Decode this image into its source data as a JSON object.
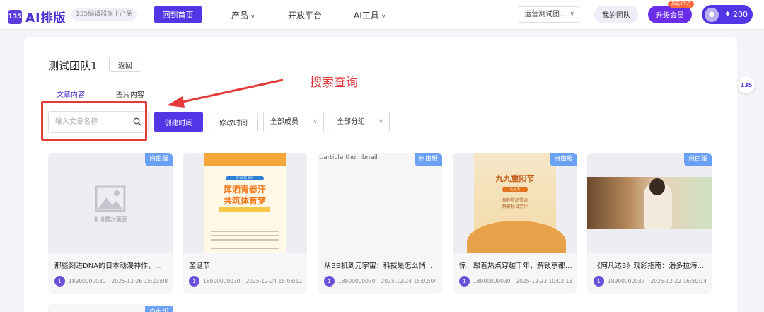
{
  "header": {
    "logo_mark": "135",
    "logo_text": "AI排版",
    "logo_sub": "135编辑器旗下产品",
    "home_button": "回到首页",
    "nav": {
      "products": "产品",
      "open_platform": "开放平台",
      "ai_tools": "AI工具"
    },
    "team_select": "运营测试团...",
    "my_team": "我的团队",
    "upgrade": "升级会员",
    "upgrade_tag": "加送4个月",
    "points": "200"
  },
  "side_badge": "135",
  "page": {
    "team_title": "测试团队1",
    "back_button": "返回",
    "annotation": "搜索查询",
    "tabs": [
      "文章内容",
      "图片内容"
    ],
    "search_placeholder": "输入文章名称",
    "filters": {
      "created_time": "创建时间",
      "modified_time": "修改时间",
      "members": "全部成员",
      "groups": "全部分组"
    }
  },
  "cards": [
    {
      "badge": "自由版",
      "placeholder": "未设置封面图",
      "title": "那些刻进DNA的日本动漫神作，资...",
      "avatar": "1",
      "user": "18900000030",
      "date": "2025-12-26 15:23:08"
    },
    {
      "badge": "",
      "poster_top": "SPORTS DAY",
      "poster_line1": "挥洒青春汗",
      "poster_line2": "共筑体育梦",
      "title": "圣诞节",
      "avatar": "1",
      "user": "18900000030",
      "date": "2025-12-24 15:08:12"
    },
    {
      "badge": "自由版",
      "broken_alt": "article thumbnail",
      "title": "从BB机到元宇宙：科技是怎么悄...",
      "avatar": "1",
      "user": "18900000030",
      "date": "2025-12-24 15:02:04"
    },
    {
      "badge": "自由版",
      "poster_title": "九九重阳节",
      "poster_pill": "九月九",
      "poster_sub1": "相伴登高望远",
      "poster_sub2": "静赏秋日芳华",
      "title": "惊！跟着热点穿越千年，解锁京都...",
      "avatar": "1",
      "user": "18900000030",
      "date": "2025-12-23 10:02:13"
    },
    {
      "badge": "自由版",
      "title": "《阿凡达3》观影指南：潘多拉海...",
      "avatar": "1",
      "user": "18900000037",
      "date": "2025-12-22 16:50:14"
    }
  ],
  "next_row_badge": "自由版",
  "colors": {
    "primary": "#5335e5",
    "badge": "#6aa1f5",
    "annotation_red": "#e0383e"
  }
}
